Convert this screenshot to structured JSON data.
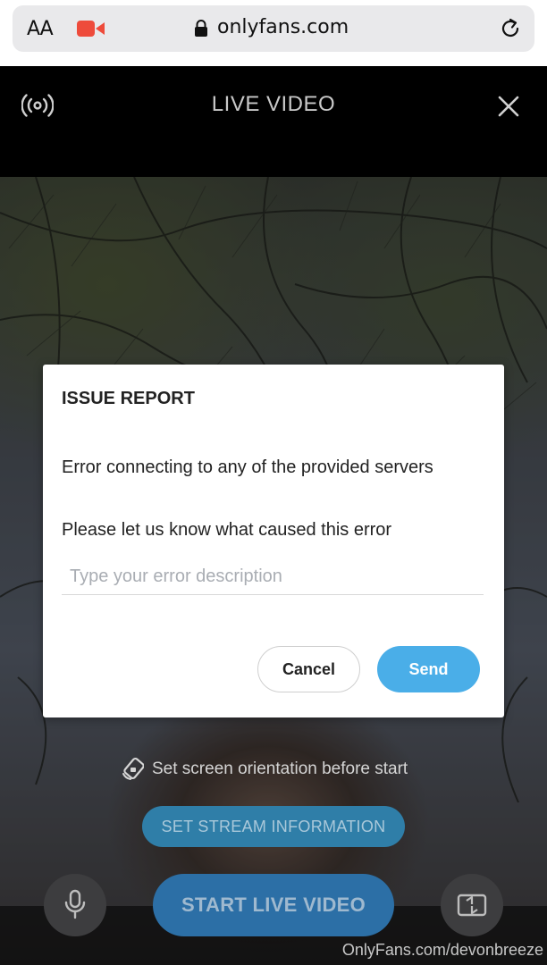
{
  "browser": {
    "text_size_label": "AA",
    "url": "onlyfans.com",
    "icons": [
      "text-size-icon",
      "recording-icon",
      "lock-icon",
      "reload-icon"
    ]
  },
  "header": {
    "title": "LIVE VIDEO",
    "icons": [
      "broadcast-icon",
      "close-icon"
    ]
  },
  "dialog": {
    "title": "ISSUE REPORT",
    "message": "Error connecting to any of the provided servers",
    "prompt": "Please let us know what caused this error",
    "input_placeholder": "Type your error description",
    "input_value": "",
    "cancel_label": "Cancel",
    "send_label": "Send"
  },
  "controls": {
    "orientation_hint": "Set screen orientation before start",
    "stream_info_label": "SET STREAM INFORMATION",
    "start_label": "START LIVE VIDEO",
    "icons": [
      "rotation-lock-icon",
      "microphone-icon",
      "flip-camera-icon"
    ]
  },
  "watermark": "OnlyFans.com/devonbreeze",
  "colors": {
    "accent": "#4aaee8",
    "start_button": "#2c6fa6",
    "stream_button": "#2f7ea8",
    "recording": "#ee4b3b"
  }
}
